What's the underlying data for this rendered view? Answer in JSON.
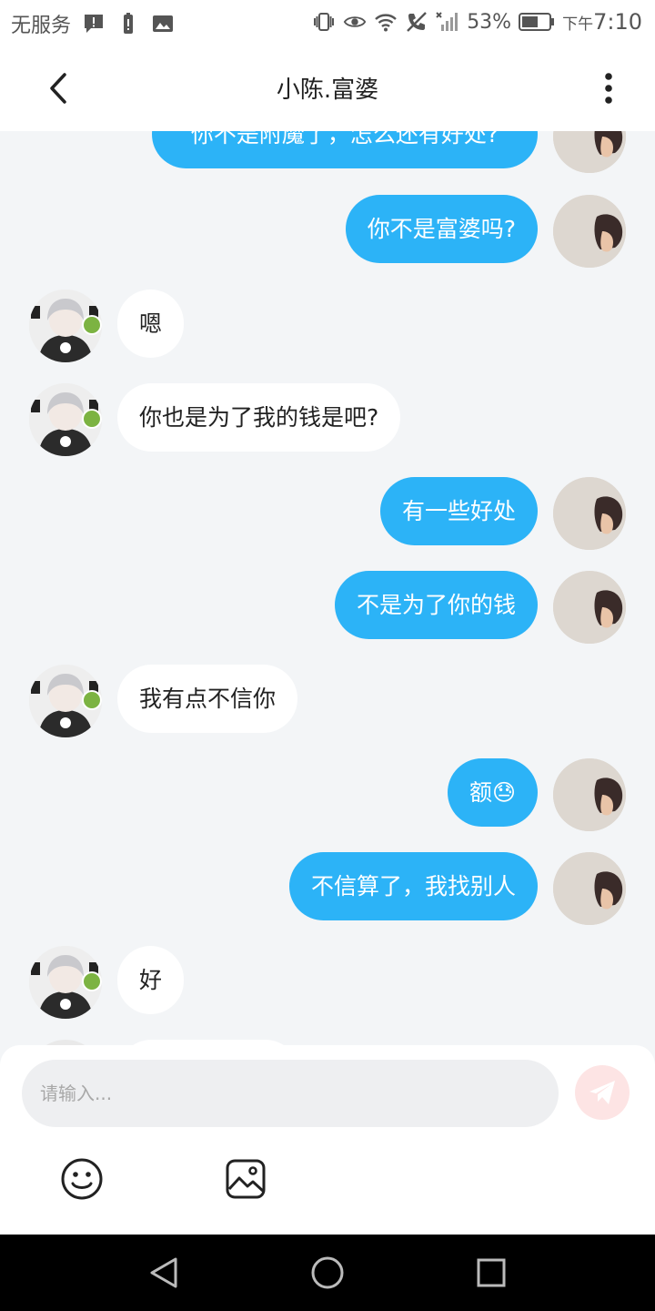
{
  "status_bar": {
    "carrier": "无服务",
    "battery_percent": "53%",
    "time_prefix": "下午",
    "time": "7:10",
    "icons": [
      "notification-icon",
      "battery-alert-icon",
      "image-icon",
      "vibrate-icon",
      "eye-icon",
      "wifi-icon",
      "no-call-icon",
      "signal-icon",
      "battery-icon"
    ]
  },
  "header": {
    "title": "小陈.富婆",
    "back_icon": "chevron-left-icon",
    "more_icon": "more-vertical-icon"
  },
  "messages": [
    {
      "sender": "self",
      "text": "你不是附魔了，怎么还有好处?"
    },
    {
      "sender": "self",
      "text": "你不是富婆吗?"
    },
    {
      "sender": "other",
      "text": "嗯"
    },
    {
      "sender": "other",
      "text": "你也是为了我的钱是吧?"
    },
    {
      "sender": "self",
      "text": "有一些好处"
    },
    {
      "sender": "self",
      "text": "不是为了你的钱"
    },
    {
      "sender": "other",
      "text": "我有点不信你"
    },
    {
      "sender": "self",
      "text": "额😓"
    },
    {
      "sender": "self",
      "text": "不信算了，我找别人"
    },
    {
      "sender": "other",
      "text": "好"
    }
  ],
  "composer": {
    "placeholder": "请输入...",
    "send_icon": "send-icon",
    "tools": [
      "emoji-icon",
      "image-icon"
    ]
  },
  "colors": {
    "self_bubble": "#2cb3f7",
    "other_bubble": "#ffffff",
    "chat_background": "#f3f5f7",
    "send_button": "#fde4e4"
  }
}
